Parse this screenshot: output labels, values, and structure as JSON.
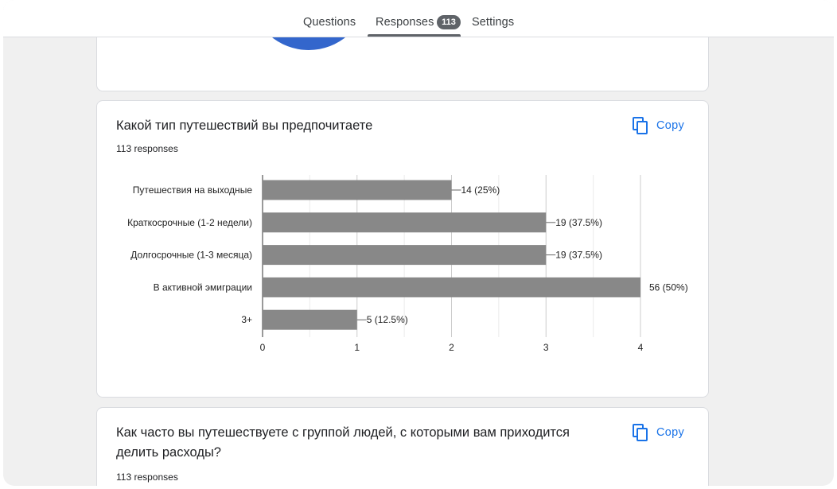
{
  "tabs": {
    "questions": "Questions",
    "responses": "Responses",
    "responses_count": "113",
    "settings": "Settings"
  },
  "question_1": {
    "title": "Какой тип путешествий вы предпочитаете",
    "responses": "113 responses",
    "copy_label": "Copy"
  },
  "question_2": {
    "title": "Как часто вы путешествуете с группой людей, с которыми вам приходится делить расходы?",
    "responses": "113 responses",
    "copy_label": "Copy"
  },
  "colors": {
    "bar": "#888888",
    "accent": "#1a73e8",
    "pie": "#3366cc"
  },
  "chart_data": {
    "type": "bar",
    "orientation": "horizontal",
    "categories": [
      "Путешествия на выходные",
      "Краткосрочные (1-2 недели)",
      "Долгосрочные (1-3 месяца)",
      "В активной эмиграции",
      "3+"
    ],
    "values": [
      2,
      3,
      3,
      4,
      1
    ],
    "value_labels": [
      "14 (25%)",
      "19 (37.5%)",
      "19 (37.5%)",
      "56 (50%)",
      "5 (12.5%)"
    ],
    "xlim": [
      0,
      4
    ],
    "xticks": [
      "0",
      "1",
      "2",
      "3",
      "4"
    ],
    "grid": true
  }
}
